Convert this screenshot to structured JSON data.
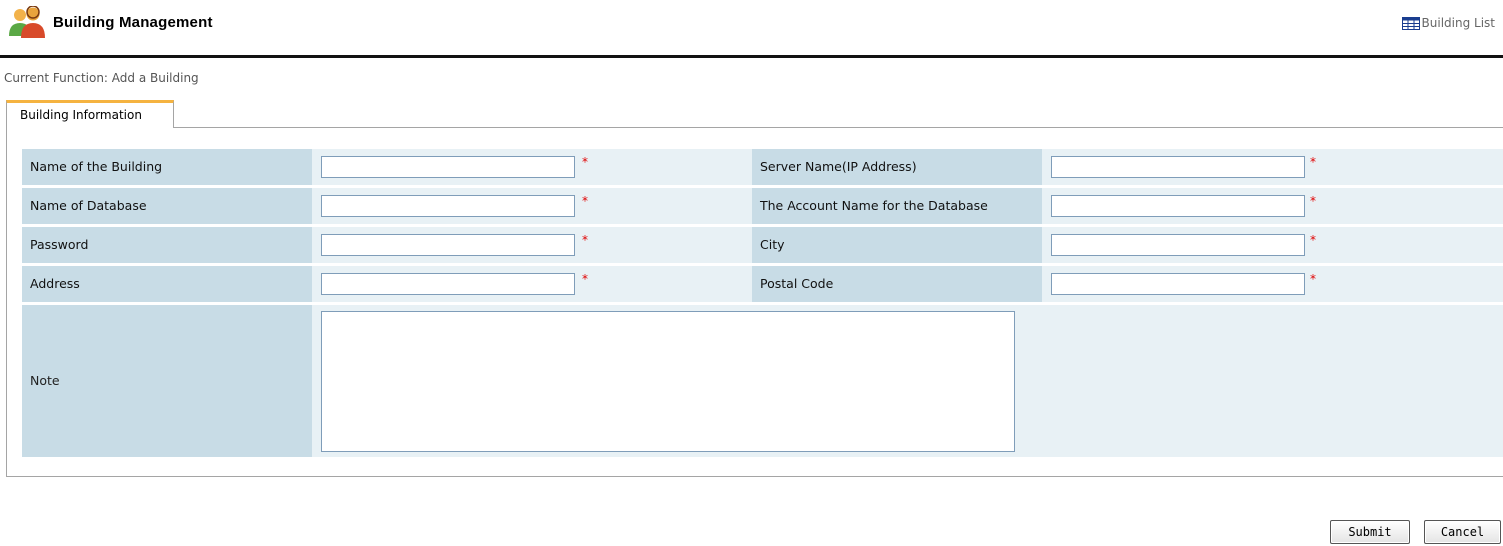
{
  "header": {
    "title": "Building Management",
    "list_link": "Building List",
    "icon": "users-icon",
    "list_icon": "table-icon"
  },
  "breadcrumb": {
    "current_function": "Current Function:  Add a Building"
  },
  "tab": {
    "label": "Building Information"
  },
  "form": {
    "rows": [
      {
        "left_label": "Name of the Building",
        "left_value": "",
        "right_label": "Server Name(IP Address)",
        "right_value": ""
      },
      {
        "left_label": "Name of Database",
        "left_value": "",
        "right_label": "The Account Name for the Database",
        "right_value": ""
      },
      {
        "left_label": "Password",
        "left_value": "",
        "right_label": "City",
        "right_value": ""
      },
      {
        "left_label": "Address",
        "left_value": "",
        "right_label": "Postal Code",
        "right_value": ""
      }
    ],
    "required_mark": "*",
    "note_label": "Note",
    "note_value": ""
  },
  "buttons": {
    "submit": "Submit",
    "cancel": "Cancel"
  },
  "colors": {
    "label_bg": "#c8dce6",
    "input_bg": "#e8f1f5",
    "tab_accent": "#f5b340",
    "required": "#e00000"
  }
}
